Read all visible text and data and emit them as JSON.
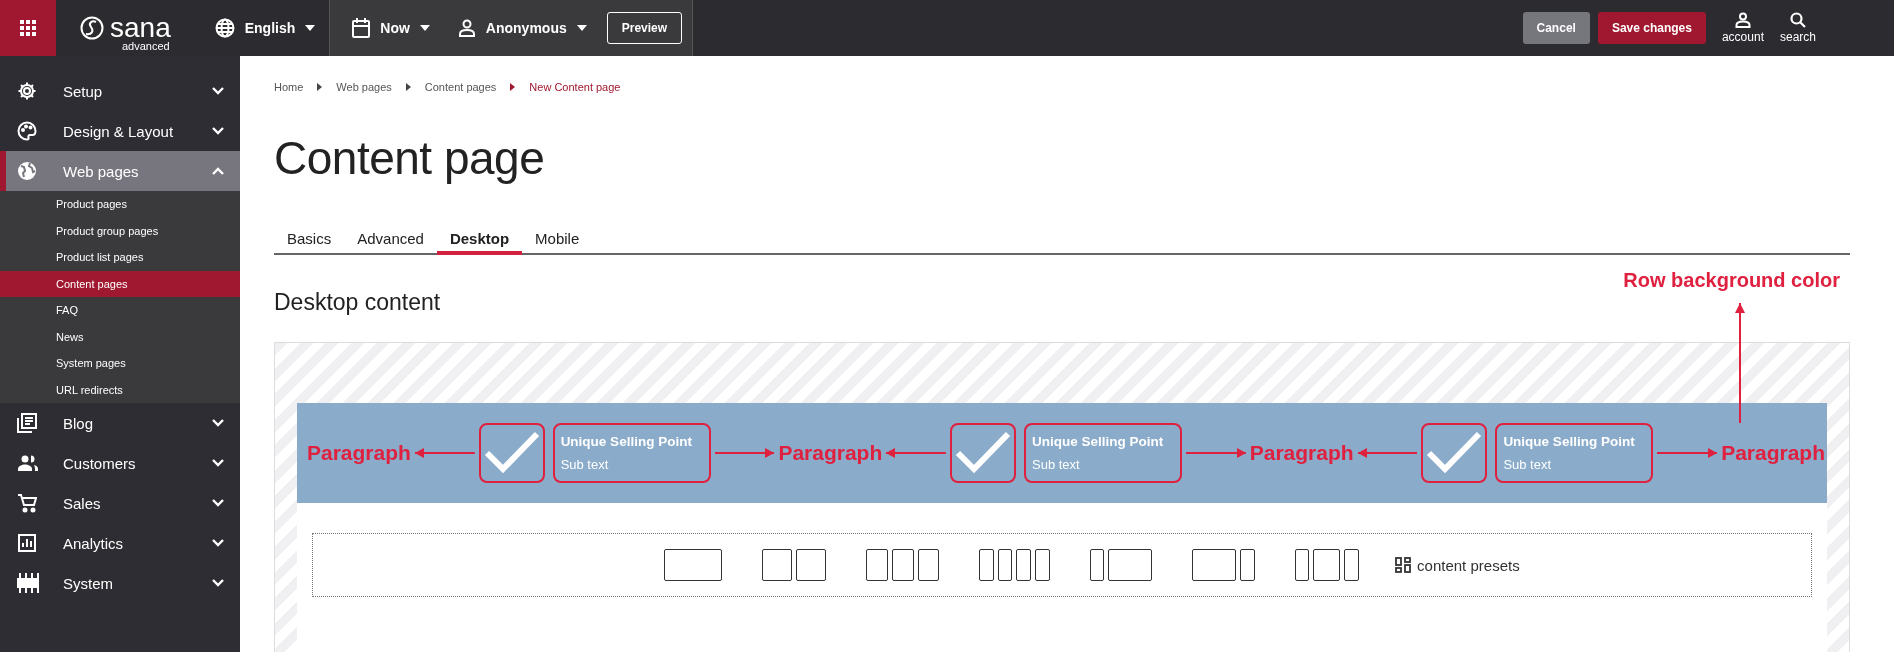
{
  "topbar": {
    "brand": "sana",
    "brand_sub": "advanced",
    "language": "English",
    "date": "Now",
    "visitor": "Anonymous",
    "preview": "Preview",
    "cancel": "Cancel",
    "save": "Save changes",
    "actions": [
      {
        "label": "account"
      },
      {
        "label": "search"
      }
    ]
  },
  "sidebar": {
    "items": [
      {
        "label": "Setup",
        "expanded": false
      },
      {
        "label": "Design & Layout",
        "expanded": false
      },
      {
        "label": "Web pages",
        "expanded": true,
        "children": [
          {
            "label": "Product pages",
            "selected": false
          },
          {
            "label": "Product group pages",
            "selected": false
          },
          {
            "label": "Product list pages",
            "selected": false
          },
          {
            "label": "Content pages",
            "selected": true
          },
          {
            "label": "FAQ",
            "selected": false
          },
          {
            "label": "News",
            "selected": false
          },
          {
            "label": "System pages",
            "selected": false
          },
          {
            "label": "URL redirects",
            "selected": false
          }
        ]
      },
      {
        "label": "Blog",
        "expanded": false
      },
      {
        "label": "Customers",
        "expanded": false
      },
      {
        "label": "Sales",
        "expanded": false
      },
      {
        "label": "Analytics",
        "expanded": false
      },
      {
        "label": "System",
        "expanded": false
      }
    ]
  },
  "breadcrumb": [
    {
      "label": "Home",
      "current": false
    },
    {
      "label": "Web pages",
      "current": false
    },
    {
      "label": "Content pages",
      "current": false
    },
    {
      "label": "New Content page",
      "current": true
    }
  ],
  "page_title": "Content page",
  "tabs": [
    {
      "label": "Basics",
      "selected": false
    },
    {
      "label": "Advanced",
      "selected": false
    },
    {
      "label": "Desktop",
      "selected": true
    },
    {
      "label": "Mobile",
      "selected": false
    }
  ],
  "section_title": "Desktop content",
  "annotation": "Row background color",
  "content_row": {
    "items": [
      {
        "kind": "paragraph",
        "label": "Paragraph"
      },
      {
        "kind": "usp",
        "title": "Unique Selling Point",
        "subtext": "Sub text"
      },
      {
        "kind": "paragraph",
        "label": "Paragraph"
      },
      {
        "kind": "usp",
        "title": "Unique Selling Point",
        "subtext": "Sub text"
      },
      {
        "kind": "paragraph",
        "label": "Paragraph"
      },
      {
        "kind": "usp",
        "title": "Unique Selling Point",
        "subtext": "Sub text"
      },
      {
        "kind": "paragraph",
        "label": "Paragraph"
      }
    ]
  },
  "presets_label": "content presets"
}
